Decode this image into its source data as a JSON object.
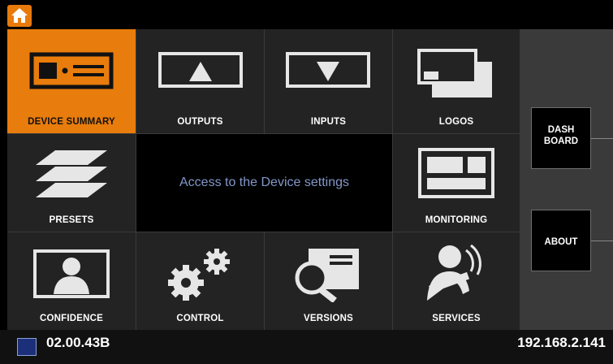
{
  "topbar": {
    "home_icon": "home-icon"
  },
  "tiles": [
    {
      "id": "device-summary",
      "label": "DEVICE SUMMARY",
      "icon": "device-icon",
      "active": true
    },
    {
      "id": "outputs",
      "label": "OUTPUTS",
      "icon": "output-arrow-icon"
    },
    {
      "id": "inputs",
      "label": "INPUTS",
      "icon": "input-arrow-icon"
    },
    {
      "id": "logos",
      "label": "LOGOS",
      "icon": "logos-icon"
    },
    {
      "id": "presets",
      "label": "PRESETS",
      "icon": "layers-icon"
    },
    {
      "id": "monitoring",
      "label": "MONITORING",
      "icon": "monitor-layout-icon"
    },
    {
      "id": "confidence",
      "label": "CONFIDENCE",
      "icon": "person-screen-icon"
    },
    {
      "id": "control",
      "label": "CONTROL",
      "icon": "gears-icon"
    },
    {
      "id": "versions",
      "label": "VERSIONS",
      "icon": "magnifier-document-icon"
    },
    {
      "id": "services",
      "label": "SERVICES",
      "icon": "service-person-icon"
    }
  ],
  "info": {
    "text": "Access to the Device settings"
  },
  "side": {
    "dashboard_label": "DASH BOARD",
    "about_label": "ABOUT"
  },
  "status": {
    "version": "02.00.43B",
    "ip": "192.168.2.141"
  },
  "colors": {
    "accent": "#e87c0c",
    "info_text": "#8497c9",
    "tile": "#232323"
  }
}
